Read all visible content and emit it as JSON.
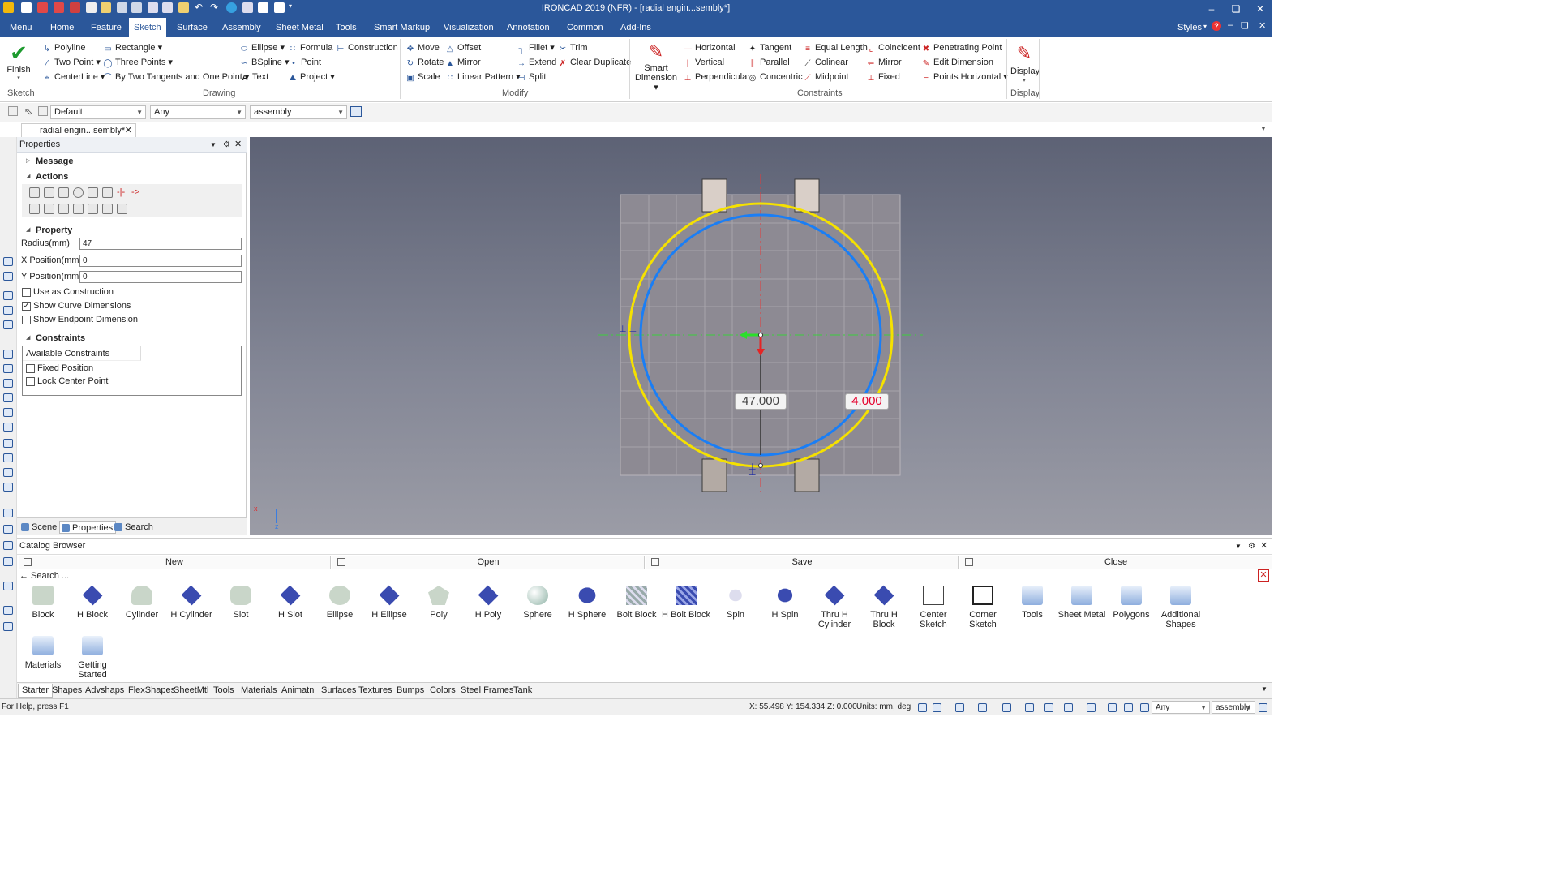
{
  "app": {
    "title": "IRONCAD 2019 (NFR) - [radial engin...sembly*]",
    "styles": "Styles"
  },
  "menu_tabs": [
    "Menu",
    "Home",
    "Feature",
    "Sketch",
    "Surface",
    "Assembly",
    "Sheet Metal",
    "Tools",
    "Smart Markup",
    "Visualization",
    "Annotation",
    "Common",
    "Add-Ins"
  ],
  "active_tab": "Sketch",
  "ribbon": {
    "sketch": {
      "finish": "Finish",
      "group": "Sketch"
    },
    "drawing": {
      "polyline": "Polyline",
      "two_point": "Two Point",
      "centerline": "CenterLine",
      "rectangle": "Rectangle",
      "three_points": "Three Points",
      "two_tangents": "By Two Tangents and One Point",
      "ellipse": "Ellipse",
      "bspline": "BSpline",
      "formula": "Formula",
      "point": "Point",
      "text": "Text",
      "construction": "Construction",
      "project": "Project",
      "group": "Drawing"
    },
    "modify": {
      "move": "Move",
      "offset": "Offset",
      "rotate": "Rotate",
      "mirror": "Mirror",
      "scale": "Scale",
      "linear_pattern": "Linear Pattern",
      "fillet": "Fillet",
      "trim": "Trim",
      "extend": "Extend",
      "clear_duplicate": "Clear Duplicate",
      "split": "Split",
      "group": "Modify"
    },
    "constraints": {
      "smart": "Smart",
      "dimension": "Dimension",
      "horizontal": "Horizontal",
      "vertical": "Vertical",
      "perpendicular": "Perpendicular",
      "tangent": "Tangent",
      "parallel": "Parallel",
      "concentric": "Concentric",
      "equal_length": "Equal Length",
      "colinear": "Colinear",
      "midpoint": "Midpoint",
      "coincident": "Coincident",
      "mirror": "Mirror",
      "fixed": "Fixed",
      "penetrating_point": "Penetrating Point",
      "edit_dimension": "Edit Dimension",
      "points_horizontal": "Points Horizontal",
      "group": "Constraints"
    },
    "display": {
      "label": "Display",
      "group": "Display"
    }
  },
  "toolbar": {
    "combo1": "Default",
    "combo2": "Any",
    "combo3": "assembly"
  },
  "doc_tab": "radial engin...sembly*",
  "properties": {
    "header": "Properties",
    "message": "Message",
    "actions": "Actions",
    "property": "Property",
    "fields": [
      {
        "label": "Radius(mm)",
        "value": "47"
      },
      {
        "label": "X Position(mm)",
        "value": "0"
      },
      {
        "label": "Y Position(mm)",
        "value": "0"
      }
    ],
    "checks": [
      {
        "label": "Use as Construction",
        "checked": false
      },
      {
        "label": "Show Curve Dimensions",
        "checked": true
      },
      {
        "label": "Show Endpoint Dimension",
        "checked": false
      }
    ],
    "constraints": "Constraints",
    "available": "Available Constraints",
    "constraint_items": [
      {
        "label": "Fixed Position",
        "checked": false
      },
      {
        "label": "Lock Center Point",
        "checked": false
      }
    ],
    "footer_tabs": [
      "Scene",
      "Properties",
      "Search"
    ]
  },
  "viewport": {
    "dim_radius": "47.000",
    "dim_offset": "4.000",
    "axis_x": "x",
    "axis_z": "z",
    "colors": {
      "outer_circle": "#f5e100",
      "inner_circle": "#1a7ef5",
      "dim_highlight": "#e5002c"
    }
  },
  "catalog": {
    "title": "Catalog Browser",
    "buttons": [
      "New",
      "Open",
      "Save",
      "Close"
    ],
    "search_placeholder": "Search ...",
    "items": [
      {
        "line1": "Block",
        "line2": ""
      },
      {
        "line1": "H Block",
        "line2": ""
      },
      {
        "line1": "Cylinder",
        "line2": ""
      },
      {
        "line1": "H Cylinder",
        "line2": ""
      },
      {
        "line1": "Slot",
        "line2": ""
      },
      {
        "line1": "H Slot",
        "line2": ""
      },
      {
        "line1": "Ellipse",
        "line2": ""
      },
      {
        "line1": "H Ellipse",
        "line2": ""
      },
      {
        "line1": "Poly",
        "line2": ""
      },
      {
        "line1": "H Poly",
        "line2": ""
      },
      {
        "line1": "Sphere",
        "line2": ""
      },
      {
        "line1": "H Sphere",
        "line2": ""
      },
      {
        "line1": "Bolt Block",
        "line2": ""
      },
      {
        "line1": "H Bolt Block",
        "line2": ""
      },
      {
        "line1": "Spin",
        "line2": ""
      },
      {
        "line1": "H Spin",
        "line2": ""
      },
      {
        "line1": "Thru H",
        "line2": "Cylinder"
      },
      {
        "line1": "Thru H Block",
        "line2": ""
      },
      {
        "line1": "Center",
        "line2": "Sketch"
      },
      {
        "line1": "Corner",
        "line2": "Sketch"
      },
      {
        "line1": "Tools",
        "line2": ""
      },
      {
        "line1": "Sheet Metal",
        "line2": ""
      },
      {
        "line1": "Polygons",
        "line2": ""
      },
      {
        "line1": "Additional",
        "line2": "Shapes"
      },
      {
        "line1": "Materials",
        "line2": ""
      },
      {
        "line1": "Getting",
        "line2": "Started"
      }
    ]
  },
  "bottom_tabs": [
    "Starter",
    "Shapes",
    "Advshaps",
    "FlexShapes",
    "SheetMtl",
    "Tools",
    "Materials",
    "Animatn",
    "Surfaces",
    "Textures",
    "Bumps",
    "Colors",
    "Steel Frames",
    "Tank"
  ],
  "status": {
    "help": "For Help, press F1",
    "coords": "X: 55.498 Y: 154.334 Z: 0.000",
    "units": "Units: mm, deg",
    "combo1": "Any",
    "combo2": "assembly"
  }
}
